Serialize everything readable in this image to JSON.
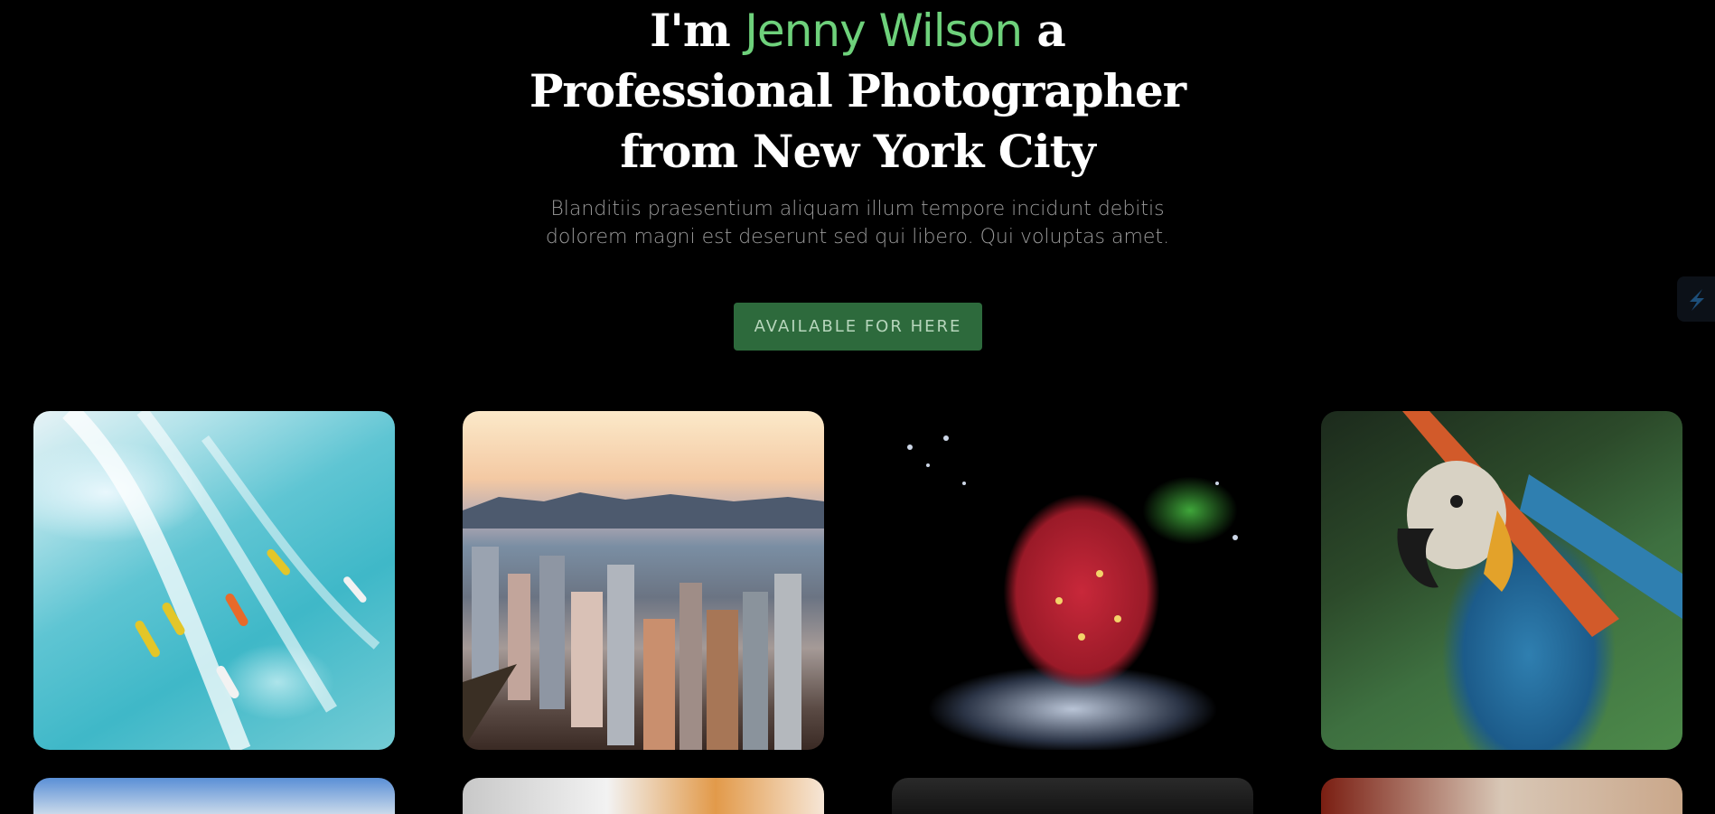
{
  "hero": {
    "line1_prefix": "I'm ",
    "name": "Jenny Wilson",
    "line1_suffix": " a",
    "line2": "Professional Photographer",
    "line3": "from New York City",
    "subtitle_line1": "Blanditiis praesentium aliquam illum tempore incidunt debitis",
    "subtitle_line2": "dolorem magni est deserunt sed qui libero. Qui voluptas amet.",
    "cta_label": "AVAILABLE FOR HERE"
  },
  "colors": {
    "background": "#000000",
    "accent_name": "#6ed17b",
    "cta_bg": "#2d6a3c"
  },
  "gallery": {
    "row1": [
      {
        "subject": "surfers-on-wave"
      },
      {
        "subject": "city-skyline-sunset"
      },
      {
        "subject": "strawberry-water-splash"
      },
      {
        "subject": "macaw-parrot"
      }
    ],
    "row2": [
      {
        "subject": "sky"
      },
      {
        "subject": "interior"
      },
      {
        "subject": "dark-scene"
      },
      {
        "subject": "animal"
      }
    ]
  },
  "floating_widget": {
    "icon": "lightning-icon"
  }
}
